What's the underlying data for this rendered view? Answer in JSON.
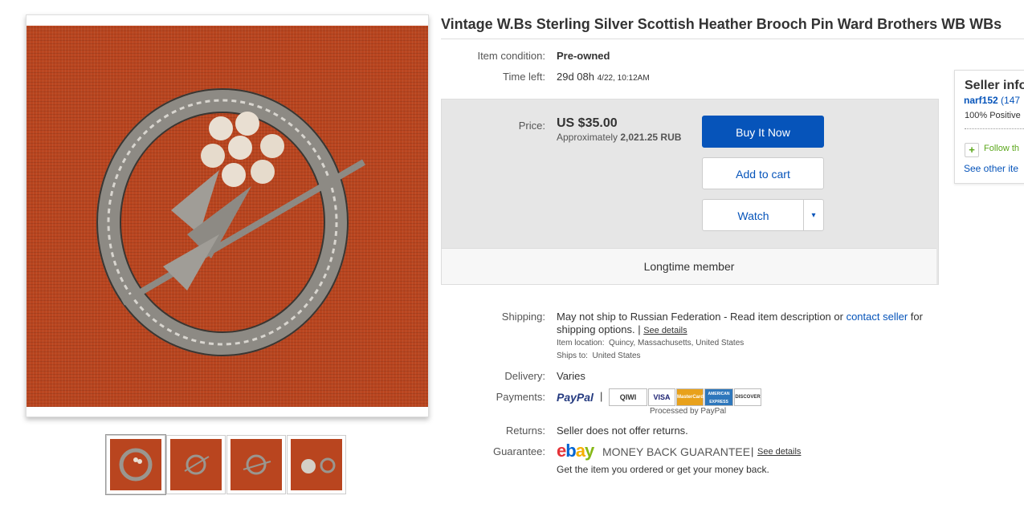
{
  "title": "Vintage W.Bs Sterling Silver Scottish Heather Brooch Pin Ward Brothers WB WBs",
  "item": {
    "condition_label": "Item condition:",
    "condition_value": "Pre-owned",
    "time_label": "Time left:",
    "time_value": "29d 08h",
    "time_date": "4/22, 10:12AM"
  },
  "price": {
    "label": "Price:",
    "value": "US $35.00",
    "approx_prefix": "Approximately",
    "approx_value": "2,021.25 RUB",
    "buy_label": "Buy It Now",
    "cart_label": "Add to cart",
    "watch_label": "Watch",
    "watch_dropdown": "▾",
    "longtime": "Longtime member"
  },
  "shipping": {
    "label": "Shipping:",
    "text_before": "May not ship to Russian Federation - Read item description or",
    "contact_link": "contact seller",
    "text_after": "for",
    "line2": "shipping options.",
    "see_details": "See details",
    "location_label": "Item location:",
    "location_value": "Quincy, Massachusetts, United States",
    "ships_to_label": "Ships to:",
    "ships_to_value": "United States"
  },
  "delivery": {
    "label": "Delivery:",
    "value": "Varies"
  },
  "payments": {
    "label": "Payments:",
    "paypal": "PayPal",
    "logos": [
      "QIWI",
      "VISA",
      "MasterCard",
      "AMERICAN EXPRESS",
      "DISCOVER"
    ],
    "processed": "Processed by PayPal"
  },
  "returns": {
    "label": "Returns:",
    "value": "Seller does not offer returns."
  },
  "guarantee": {
    "label": "Guarantee:",
    "ebay_logo": "ebay",
    "mbg": "MONEY BACK GUARANTEE",
    "see_details": "See details",
    "subtext": "Get the item you ordered or get your money back."
  },
  "seller": {
    "title": "Seller info",
    "name": "narf152",
    "feedback_partial": "(147",
    "positive": "100% Positive",
    "follow": "Follow th",
    "see_other": "See other ite"
  },
  "colors": {
    "link": "#0654ba",
    "button": "#0654ba",
    "fabric": "#b9451f"
  }
}
